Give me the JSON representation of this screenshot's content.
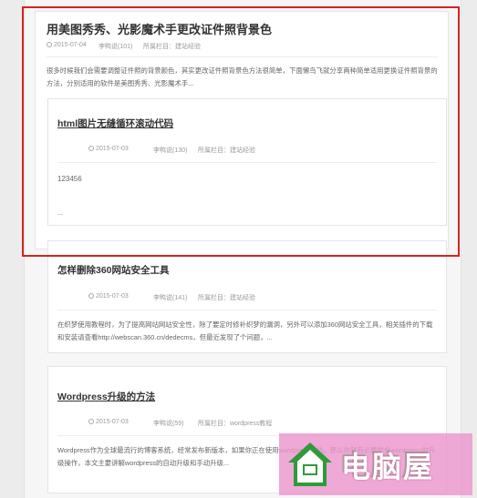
{
  "posts": [
    {
      "title": "用美图秀秀、光影魔术手更改证件照背景色",
      "date": "2015-07-04",
      "author": "李鸭说(101)",
      "category": "所属栏目：建站经验",
      "excerpt": "很多时候我们会需要调整证件照的背景颜色，其实更改证件照背景色方法很简单，下面懒鸟飞就分享两种简单适用更换证件照背景的方法，分别适用的软件是美图秀秀、光影魔术手..."
    },
    {
      "title": "html图片无缝循环滚动代码",
      "date": "2015-07-03",
      "author": "李鸭说(130)",
      "category": "所属栏目：建站经验",
      "excerpt": "123456",
      "more": "..."
    },
    {
      "title": "怎样删除360网站安全工具",
      "date": "2015-07-03",
      "author": "李鸭说(141)",
      "category": "所属栏目：建站经验",
      "excerpt": "在织梦使用教程时，为了提高网站网站安全性，除了要定时修补织梦的漏洞，另外可以添加360网站安全工具，相关插件的下载和安装请查看http://webscan.360.cn/dedecms，但最近发现了个问题，..."
    },
    {
      "title": "Wordpress升级的方法",
      "date": "2015-07-03",
      "author": "李鸭说(59)",
      "category": "所属栏目：wordpress教程",
      "excerpt": "Wordpress作为全球最流行的博客系统，经常发布新版本，如果你正在使用wordpress建站，那么你就有必要学会wordpress的升级操作，本文主要讲解wordpress的自动升级和手动升级..."
    }
  ],
  "watermark": {
    "text": "电脑屋",
    "logo_icon": "house-logo-icon"
  },
  "colors": {
    "highlight_frame": "#d42323",
    "watermark_bg": "#ec96cd",
    "logo_green": "#2f9a3c"
  }
}
